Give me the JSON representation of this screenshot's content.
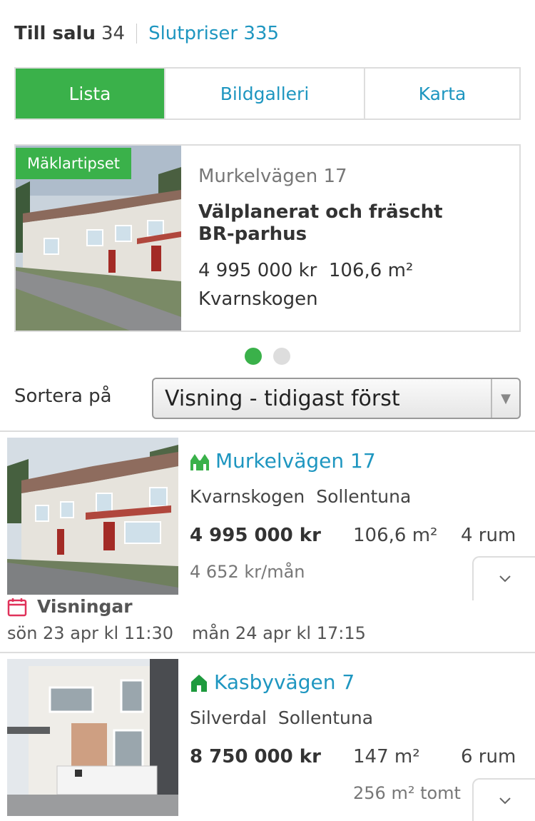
{
  "header": {
    "for_sale_label": "Till salu",
    "for_sale_count": "34",
    "sold_label": "Slutpriser 335"
  },
  "tabs": [
    {
      "label": "Lista",
      "active": true
    },
    {
      "label": "Bildgalleri",
      "active": false
    },
    {
      "label": "Karta",
      "active": false
    }
  ],
  "featured": {
    "badge": "Mäklartipset",
    "street": "Murkelvägen 17",
    "title": "Välplanerat och fräscht BR-parhus",
    "price": "4 995 000 kr",
    "size": "106,6 m²",
    "area": "Kvarnskogen"
  },
  "pagination": {
    "pages": 2,
    "current": 1
  },
  "sort": {
    "label": "Sortera på",
    "selected": "Visning - tidigast först"
  },
  "listings": [
    {
      "street": "Murkelvägen 17",
      "area": "Kvarnskogen",
      "municipality": "Sollentuna",
      "price": "4 995 000 kr",
      "size": "106,6 m²",
      "rooms": "4 rum",
      "fee": "4 652 kr/mån",
      "showings_label": "Visningar",
      "showings": [
        "sön 23 apr kl 11:30",
        "mån 24 apr kl 17:15"
      ],
      "icon": "row-house-icon"
    },
    {
      "street": "Kasbyvägen 7",
      "area": "Silverdal",
      "municipality": "Sollentuna",
      "price": "8 750 000 kr",
      "size": "147 m²",
      "rooms": "6 rum",
      "plot": "256 m² tomt",
      "icon": "house-icon"
    }
  ],
  "colors": {
    "accent_green": "#3ab14a",
    "link_blue": "#1e96c0",
    "calendar_red": "#e0325a"
  }
}
